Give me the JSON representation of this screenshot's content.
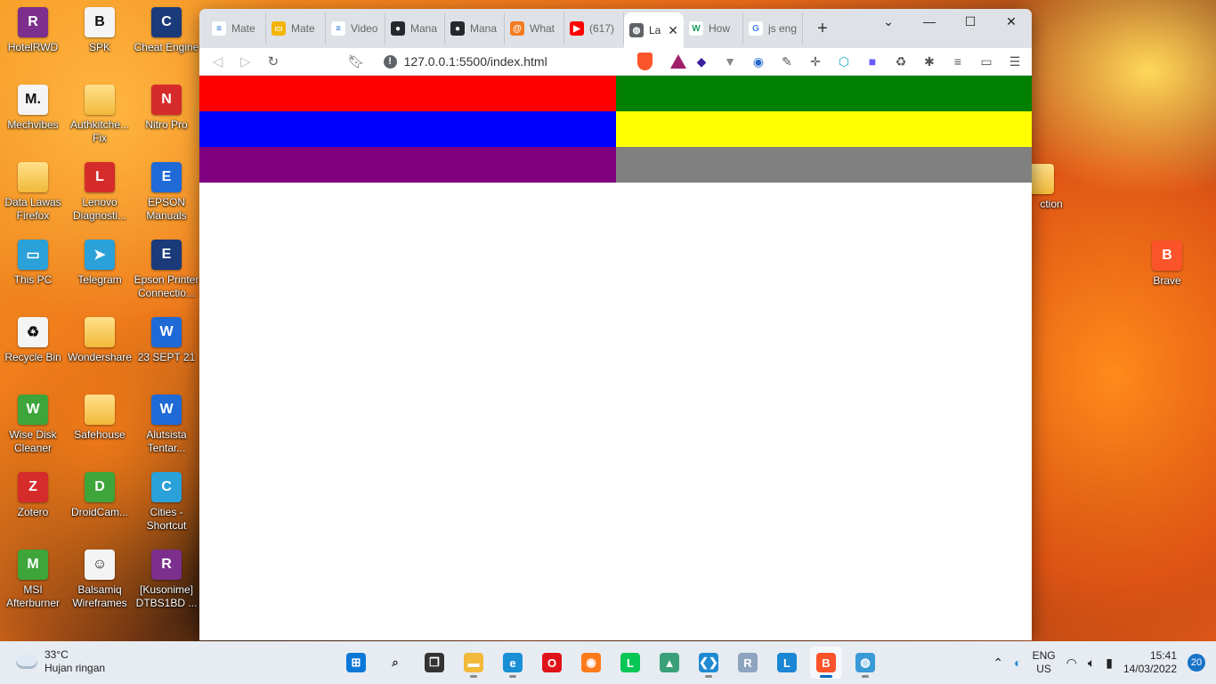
{
  "desktop": {
    "icons_left": [
      {
        "label": "HotelRWD",
        "icon": "winrar-icon"
      },
      {
        "label": "SPK",
        "icon": "brave-file-icon"
      },
      {
        "label": "Cheat Engine",
        "icon": "cheat-engine-icon"
      },
      {
        "label": "Mechvibes",
        "icon": "mechvibes-icon"
      },
      {
        "label": "Authkitche... Fix",
        "icon": "folder-icon"
      },
      {
        "label": "Nitro Pro",
        "icon": "nitro-pro-icon"
      },
      {
        "label": "Data Lawas Firefox",
        "icon": "folder-icon"
      },
      {
        "label": "Lenovo Diagnosti...",
        "icon": "lenovo-diagnostics-icon"
      },
      {
        "label": "EPSON Manuals",
        "icon": "epson-manuals-icon"
      },
      {
        "label": "This PC",
        "icon": "monitor-icon"
      },
      {
        "label": "Telegram",
        "icon": "telegram-icon"
      },
      {
        "label": "Epson Printer Connectio...",
        "icon": "epson-printer-icon"
      },
      {
        "label": "Recycle Bin",
        "icon": "recycle-bin-icon"
      },
      {
        "label": "Wondershare",
        "icon": "folder-icon"
      },
      {
        "label": "23 SEPT 21",
        "icon": "word-document-icon"
      },
      {
        "label": "Wise Disk Cleaner",
        "icon": "wise-disk-cleaner-icon"
      },
      {
        "label": "Safehouse",
        "icon": "folder-icon"
      },
      {
        "label": "Alutsista Tentar...",
        "icon": "word-document-icon"
      },
      {
        "label": "Zotero",
        "icon": "zotero-icon"
      },
      {
        "label": "DroidCam...",
        "icon": "droidcam-icon"
      },
      {
        "label": "Cities - Shortcut",
        "icon": "cities-icon"
      },
      {
        "label": "MSI Afterburner",
        "icon": "msi-afterburner-icon"
      },
      {
        "label": "Balsamiq Wireframes",
        "icon": "balsamiq-icon"
      },
      {
        "label": "[Kusonime] DTBS1BD ...",
        "icon": "winrar-icon"
      }
    ],
    "icon_right_partial": "ction",
    "icon_right_brave": "Brave"
  },
  "browser": {
    "tabs": [
      {
        "title": "Mate",
        "icon": "page-icon"
      },
      {
        "title": "Mate",
        "icon": "slides-icon"
      },
      {
        "title": "Video",
        "icon": "page-icon"
      },
      {
        "title": "Mana",
        "icon": "github-icon"
      },
      {
        "title": "Mana",
        "icon": "github-icon"
      },
      {
        "title": "What",
        "icon": "orange-swirl-icon"
      },
      {
        "title": "(617)",
        "icon": "youtube-icon"
      },
      {
        "title": "La",
        "icon": "globe-icon",
        "active": true
      },
      {
        "title": "How",
        "icon": "w-logo-icon"
      },
      {
        "title": "js eng",
        "icon": "google-icon"
      }
    ],
    "new_tab": "+",
    "url": "127.0.0.1:5500/index.html"
  },
  "page": {
    "blocks": [
      {
        "color": "#ff0000"
      },
      {
        "color": "#008000"
      },
      {
        "color": "#0000ff"
      },
      {
        "color": "#ffff00"
      },
      {
        "color": "#800080"
      },
      {
        "color": "#808080"
      }
    ]
  },
  "taskbar": {
    "weather": {
      "temp": "33°C",
      "desc": "Hujan ringan"
    },
    "apps": [
      {
        "name": "start-icon",
        "active": false
      },
      {
        "name": "search-icon",
        "active": false
      },
      {
        "name": "task-view-icon",
        "active": false
      },
      {
        "name": "file-explorer-icon",
        "active": false
      },
      {
        "name": "edge-icon",
        "active": false
      },
      {
        "name": "opera-icon",
        "active": false
      },
      {
        "name": "firefox-icon",
        "active": false
      },
      {
        "name": "line-icon",
        "active": false
      },
      {
        "name": "app-icon",
        "active": false
      },
      {
        "name": "vscode-icon",
        "active": false
      },
      {
        "name": "r-icon",
        "active": false
      },
      {
        "name": "l-app-icon",
        "active": false
      },
      {
        "name": "brave-icon",
        "active": true
      },
      {
        "name": "globe-app-icon",
        "active": false
      }
    ],
    "lang": "ENG",
    "region": "US",
    "time": "15:41",
    "date": "14/03/2022",
    "notifications": "20"
  }
}
